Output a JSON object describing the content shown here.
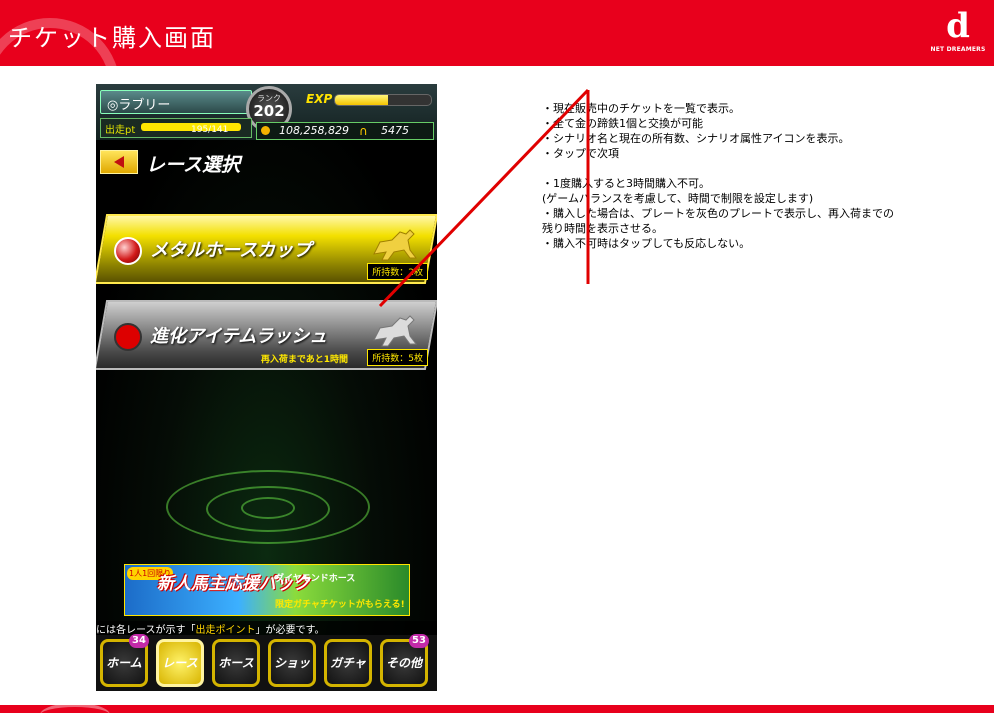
{
  "header": {
    "title": "チケット購入画面",
    "logo_text": "NET DREAMERS"
  },
  "phone": {
    "player_name": "◎ラブリー",
    "rank_label": "ランク",
    "rank_value": "202",
    "exp_label": "EXP",
    "exp_progress": 0.55,
    "pt_label": "出走pt",
    "pt_value": "195/141",
    "pt_progress": 1.0,
    "coins": "108,258,829",
    "horseshoes": "5475",
    "screen_title": "レース選択",
    "tickets": [
      {
        "name": "メタルホースカップ",
        "owned": "所持数：2枚",
        "restock": ""
      },
      {
        "name": "進化アイテムラッシュ",
        "owned": "所持数：5枚",
        "restock": "再入荷まであと1時間"
      }
    ],
    "banner": {
      "small": "1人1回限り",
      "main": "新人馬主応援パック",
      "sub": "ダイヤモンドホース",
      "sub2": "限定ガチャチケットがもらえる!"
    },
    "notice_prefix": "には各レースが示す「",
    "notice_highlight": "出走ポイント",
    "notice_suffix": "」が必要です。",
    "nav": [
      {
        "label": "ホーム",
        "badge": "34"
      },
      {
        "label": "レース",
        "badge": ""
      },
      {
        "label": "ホース",
        "badge": ""
      },
      {
        "label": "ショップ",
        "badge": ""
      },
      {
        "label": "ガチャ",
        "badge": ""
      },
      {
        "label": "その他",
        "badge": "53"
      }
    ]
  },
  "notes": [
    "・現在販売中のチケットを一覧で表示。",
    "・全て金の蹄鉄1個と交換が可能",
    "・シナリオ名と現在の所有数、シナリオ属性アイコンを表示。",
    "・タップで次項",
    "",
    "・1度購入すると3時間購入不可。",
    "(ゲームバランスを考慮して、時間で制限を設定します)",
    "・購入した場合は、プレートを灰色のプレートで表示し、再入荷までの",
    "残り時間を表示させる。",
    "・購入不可時はタップしても反応しない。"
  ],
  "colors": {
    "brand_red": "#e8001c",
    "accent_yellow": "#ffe200",
    "arrow_red": "#e00000"
  }
}
